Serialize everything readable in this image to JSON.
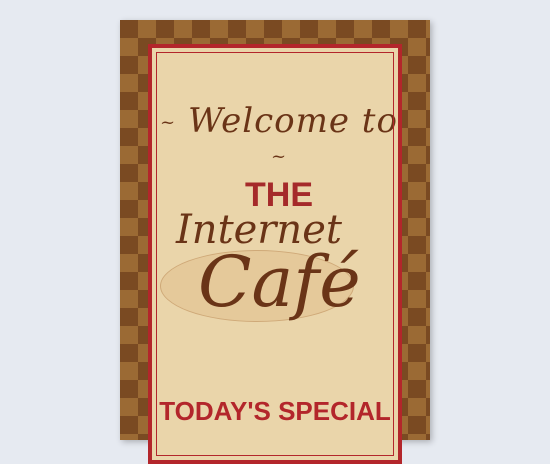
{
  "sign": {
    "welcome_text": "Welcome to",
    "dash_left": "~",
    "dash_right": "~",
    "the_text": "THE",
    "internet_text": "Internet",
    "cafe_text": "Café",
    "special_text": "TODAY'S SPECIAL"
  },
  "colors": {
    "background": "#e6eaf1",
    "border_brown": "#7a4a22",
    "panel_cream": "#ead5aa",
    "accent_red": "#b3262b",
    "text_brown": "#6a3417"
  }
}
